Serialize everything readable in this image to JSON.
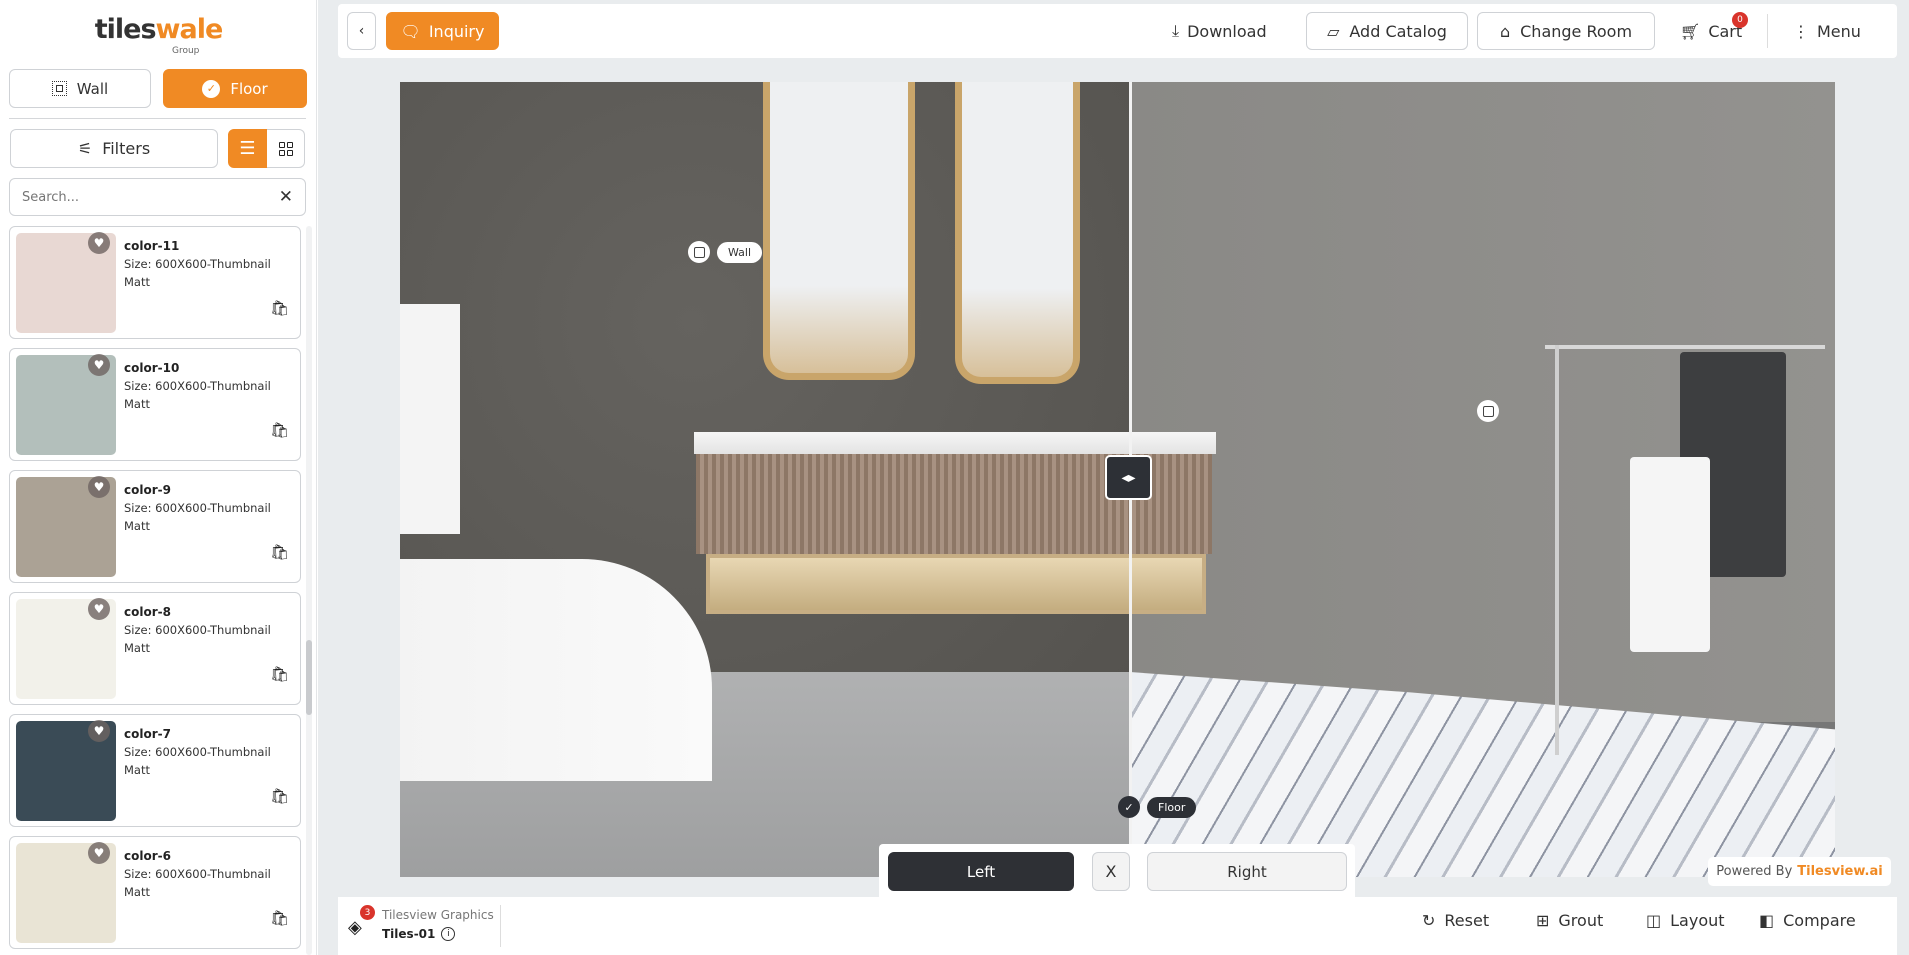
{
  "brand": {
    "logo_main": "tiles",
    "logo_accent": "wale",
    "logo_sub": "Group",
    "accent_color": "#f08a24"
  },
  "sidebar": {
    "surface_tabs": [
      {
        "label": "Wall",
        "icon": "wall-select-icon",
        "active": false
      },
      {
        "label": "Floor",
        "icon": "verified-badge-icon",
        "active": true
      }
    ],
    "filters_label": "Filters",
    "view_modes": [
      {
        "icon": "list-icon",
        "active": true
      },
      {
        "icon": "grid-icon",
        "active": false
      }
    ],
    "search": {
      "placeholder": "Search...",
      "value": ""
    },
    "products": [
      {
        "name": "color-11",
        "size": "Size: 600X600-Thumbnail",
        "finish": "Matt",
        "color": "#e8d8d3"
      },
      {
        "name": "color-10",
        "size": "Size: 600X600-Thumbnail",
        "finish": "Matt",
        "color": "#b3bfbb"
      },
      {
        "name": "color-9",
        "size": "Size: 600X600-Thumbnail",
        "finish": "Matt",
        "color": "#aba295"
      },
      {
        "name": "color-8",
        "size": "Size: 600X600-Thumbnail",
        "finish": "Matt",
        "color": "#f2f1ea"
      },
      {
        "name": "color-7",
        "size": "Size: 600X600-Thumbnail",
        "finish": "Matt",
        "color": "#3a4b56"
      },
      {
        "name": "color-6",
        "size": "Size: 600X600-Thumbnail",
        "finish": "Matt",
        "color": "#e9e4d5"
      }
    ]
  },
  "topbar": {
    "inquiry": "Inquiry",
    "download": "Download",
    "add_catalog": "Add Catalog",
    "change_room": "Change Room",
    "cart": "Cart",
    "cart_count": "0",
    "menu": "Menu"
  },
  "viewer": {
    "wall_tag": "Wall",
    "floor_tag": "Floor",
    "compare": {
      "left": "Left",
      "close": "X",
      "right": "Right",
      "active": "Left"
    },
    "powered_by": "Powered By",
    "powered_brand": "Tilesview.ai"
  },
  "bottombar": {
    "layer_count": "3",
    "company": "Tilesview Graphics",
    "tile_name": "Tiles-01",
    "reset": "Reset",
    "grout": "Grout",
    "layout": "Layout",
    "compare": "Compare"
  }
}
